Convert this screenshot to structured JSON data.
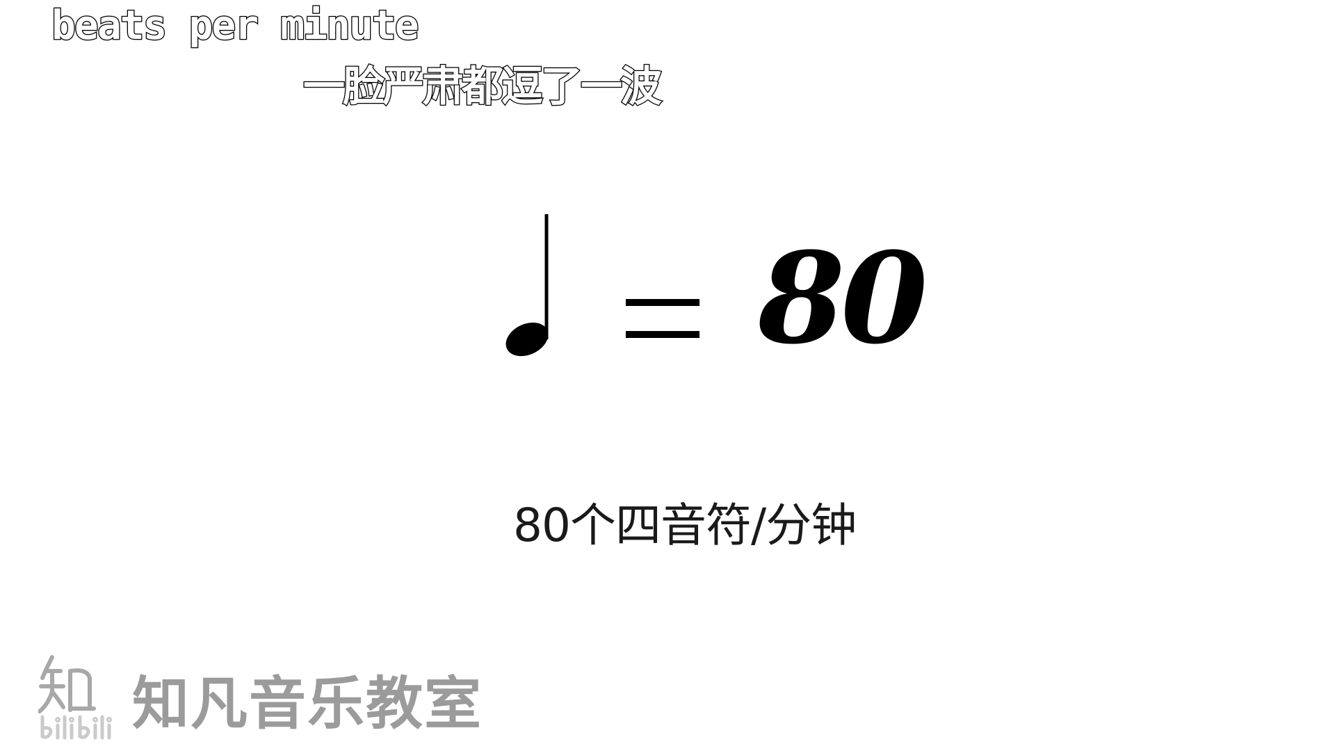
{
  "danmaku": [
    {
      "text": "beats per minute"
    },
    {
      "text": "一脸严肃都逗了一波"
    }
  ],
  "tempo_marking": {
    "note_icon": "quarter-note-icon",
    "equals_icon": "equals-sign-icon",
    "bpm_value": "80"
  },
  "caption": "80个四音符/分钟",
  "watermark": {
    "channel_name": "知凡音乐教室",
    "logo_icon": "zhifan-logo-icon",
    "platform_icon": "bilibili-logo-icon"
  },
  "colors": {
    "background": "#ffffff",
    "text": "#000000",
    "watermark": "#8a8a8a"
  }
}
